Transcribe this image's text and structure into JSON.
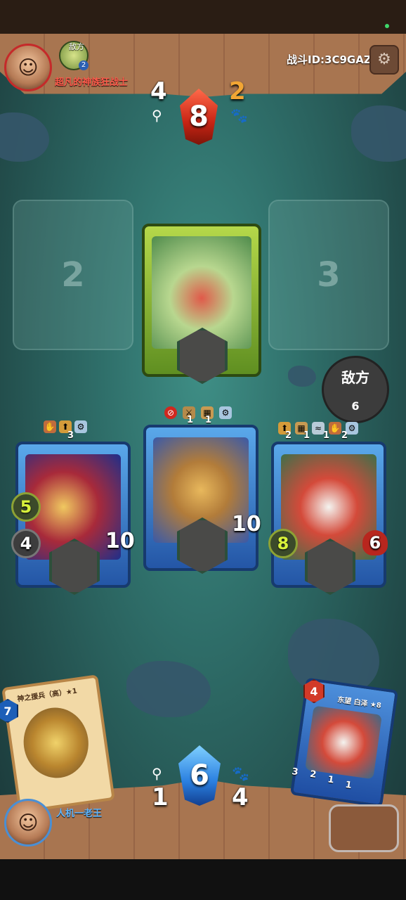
{
  "top": {
    "opponent_name": "超凡的神族狂战士",
    "opponent_side_label": "敌方",
    "opponent_rank": "2",
    "battle_id": "战斗ID:3C9GAZ"
  },
  "score": {
    "enemy_left": "4",
    "enemy_center": "8",
    "enemy_right": "2",
    "player_left": "1",
    "player_center": "6",
    "player_right": "4"
  },
  "board": {
    "slot_left_number": "2",
    "slot_right_number": "3"
  },
  "cards": {
    "left": {
      "badge_top": "3",
      "power": "5",
      "attack": "4",
      "health": "10"
    },
    "middle": {
      "badge_a": "1",
      "badge_b": "1",
      "health": "10"
    },
    "right": {
      "badge_a": "2",
      "badge_b": "1",
      "badge_c": "1",
      "badge_d": "2",
      "power": "8",
      "health": "6"
    }
  },
  "enemy_button": {
    "label": "敌方",
    "count": "6"
  },
  "hand": {
    "left_card": {
      "cost": "7",
      "title": "神之援兵（高）★1"
    },
    "right_card": {
      "cost": "4",
      "title": "东望 白泽 ★8",
      "stat_a": "3",
      "stat_b": "2",
      "stat_c": "1",
      "stat_d": "1"
    }
  },
  "player": {
    "name": "人机一老王"
  },
  "colors": {
    "enemy_accent": "#ff5a4b",
    "card_green": "#7fae32",
    "card_blue": "#3f83d0",
    "gem_red": "#d83a22",
    "gem_blue": "#2f86e8",
    "power_green": "#d8f23b"
  }
}
